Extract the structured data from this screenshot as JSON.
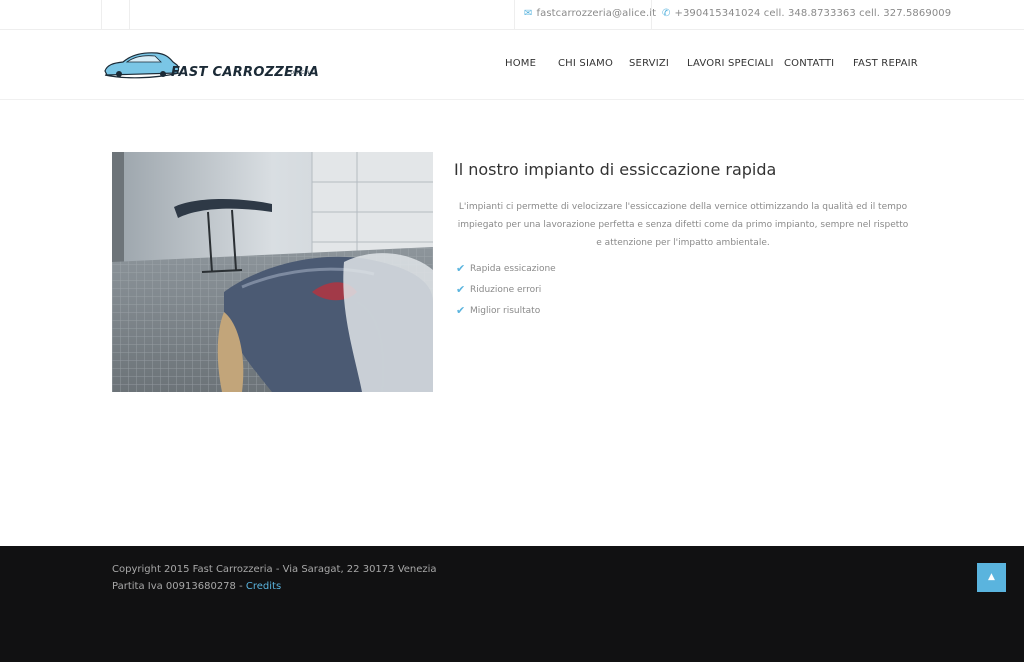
{
  "topbar": {
    "email": "fastcarrozzeria@alice.it",
    "phone": "+390415341024 cell. 348.8733363 cell. 327.5869009",
    "email_icon": "envelope-icon",
    "phone_icon": "phone-icon"
  },
  "logo": {
    "name": "FAST CARROZZERIA",
    "sub": "- OFFICINA"
  },
  "nav": {
    "items": [
      {
        "label": "HOME"
      },
      {
        "label": "CHI SIAMO"
      },
      {
        "label": "SERVIZI"
      },
      {
        "label": "LAVORI SPECIALI"
      },
      {
        "label": "CONTATTI"
      },
      {
        "label": "FAST REPAIR"
      }
    ]
  },
  "main": {
    "title": "Il nostro impianto di essiccazione rapida",
    "description": "L'impianti ci permette di velocizzare l'essiccazione della vernice ottimizzando la qualità ed il tempo impiegato per una lavorazione perfetta e senza difetti come da primo impianto, sempre nel rispetto e attenzione per l'impatto ambientale.",
    "features": [
      "Rapida essicazione",
      "Riduzione errori",
      "Miglior risultato"
    ]
  },
  "footer": {
    "copyright": "Copyright 2015 Fast Carrozzeria - Via Saragat, 22 30173 Venezia",
    "vat": "Partita Iva 00913680278 - ",
    "credits": "Credits",
    "back_to_top_icon": "chevron-up-icon"
  },
  "colors": {
    "accent": "#5ab4de",
    "footer_bg": "#111112",
    "text_muted": "#8a8a8a"
  }
}
